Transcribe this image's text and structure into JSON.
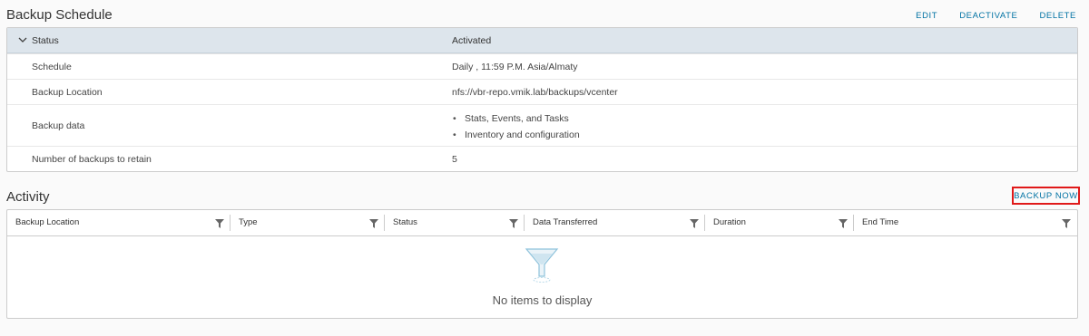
{
  "schedule": {
    "title": "Backup Schedule",
    "actions": {
      "edit": "EDIT",
      "deactivate": "DEACTIVATE",
      "delete": "DELETE"
    },
    "header": {
      "label": "Status",
      "value": "Activated"
    },
    "rows": [
      {
        "label": "Schedule",
        "value": "Daily , 11:59 P.M. Asia/Almaty"
      },
      {
        "label": "Backup Location",
        "value": "nfs://vbr-repo.vmik.lab/backups/vcenter"
      },
      {
        "label": "Backup data",
        "items": [
          "Stats, Events, and Tasks",
          "Inventory and configuration"
        ]
      },
      {
        "label": "Number of backups to retain",
        "value": "5"
      }
    ]
  },
  "activity": {
    "title": "Activity",
    "backup_now": "BACKUP NOW",
    "columns": [
      "Backup Location",
      "Type",
      "Status",
      "Data Transferred",
      "Duration",
      "End Time"
    ],
    "empty_text": "No items to display"
  },
  "icons": {
    "collapse": "chevron-down-icon",
    "filter": "filter-icon",
    "empty": "funnel-empty-icon"
  },
  "colors": {
    "link": "#0072a3",
    "header_bg": "#dde5ec",
    "highlight_border": "#e01919"
  }
}
